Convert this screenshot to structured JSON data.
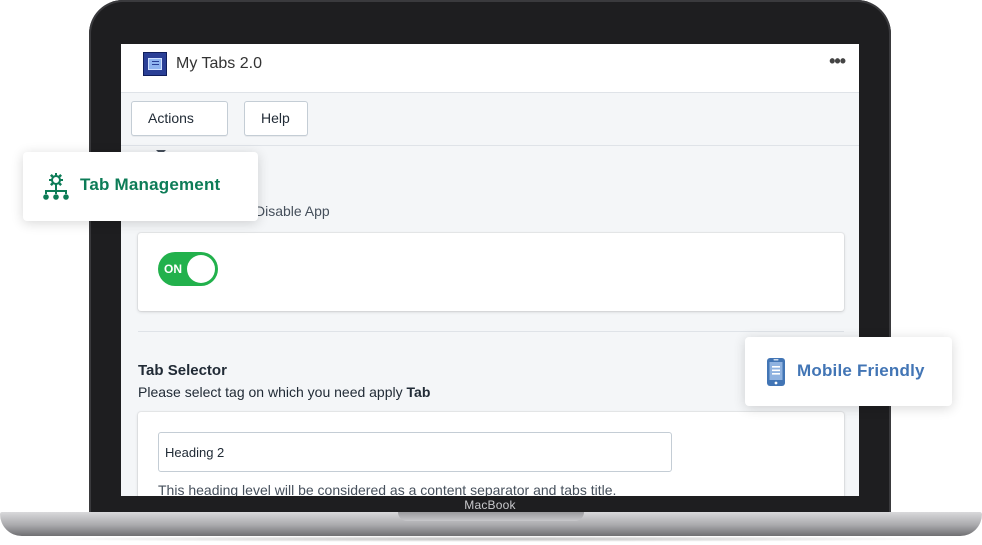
{
  "app": {
    "title": "My Tabs 2.0"
  },
  "toolbar": {
    "actions_label": "Actions",
    "help_label": "Help"
  },
  "enable_section": {
    "label": "Disable App",
    "toggle_label": "ON"
  },
  "tab_selector": {
    "title": "Tab Selector",
    "description_prefix": "Please select tag on which you need apply ",
    "description_bold": "Tab",
    "input_value": "Heading 2",
    "help_text": "This heading level will be considered as a content separator and tabs title."
  },
  "badges": {
    "tab_management": "Tab Management",
    "mobile_friendly": "Mobile Friendly"
  },
  "device": {
    "brand": "MacBook"
  },
  "colors": {
    "toggle_on": "#22b14c",
    "tab_badge": "#0d7c57",
    "mobile_badge": "#4275b5",
    "logo": "#2a3f96"
  }
}
